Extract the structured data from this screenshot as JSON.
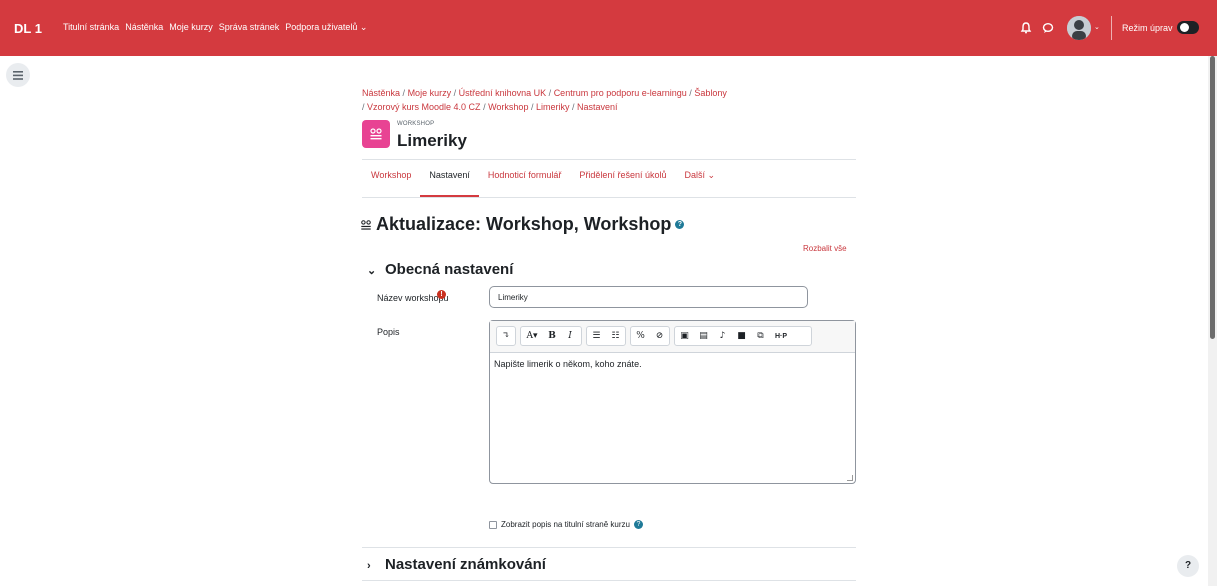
{
  "navbar": {
    "brand": "DL 1",
    "links": [
      "Titulní stránka",
      "Nástěnka",
      "Moje kurzy",
      "Správa stránek",
      "Podpora uživatelů ⌄"
    ],
    "edit_mode_label": "Režim úprav",
    "color": "#d43a3f"
  },
  "breadcrumb": {
    "items": [
      "Nástěnka",
      "Moje kurzy",
      "Ústřední knihovna UK",
      "Centrum pro podporu e-learningu",
      "Šablony",
      "Vzorový kurs Moodle 4.0 CZ",
      "Workshop",
      "Limeriky",
      "Nastavení"
    ]
  },
  "header": {
    "pretitle": "WORKSHOP",
    "title": "Limeriky",
    "icon": "workshop-icon"
  },
  "tabs": [
    {
      "label": "Workshop",
      "active": false
    },
    {
      "label": "Nastavení",
      "active": true
    },
    {
      "label": "Hodnoticí formulář",
      "active": false
    },
    {
      "label": "Přidělení řešení úkolů",
      "active": false
    },
    {
      "label": "Další ⌄",
      "active": false
    }
  ],
  "main": {
    "heading": "Aktualizace: Workshop, Workshop",
    "expand_all": "Rozbalit vše",
    "section_general": "Obecná nastavení",
    "section_grading": "Nastavení známkování",
    "name_label": "Název workshopu",
    "name_value": "Limeriky",
    "desc_label": "Popis",
    "desc_text": "Napište limerik o někom, koho znáte.",
    "show_desc_label": "Zobrazit popis na titulní straně kurzu"
  },
  "help_fab": "?"
}
